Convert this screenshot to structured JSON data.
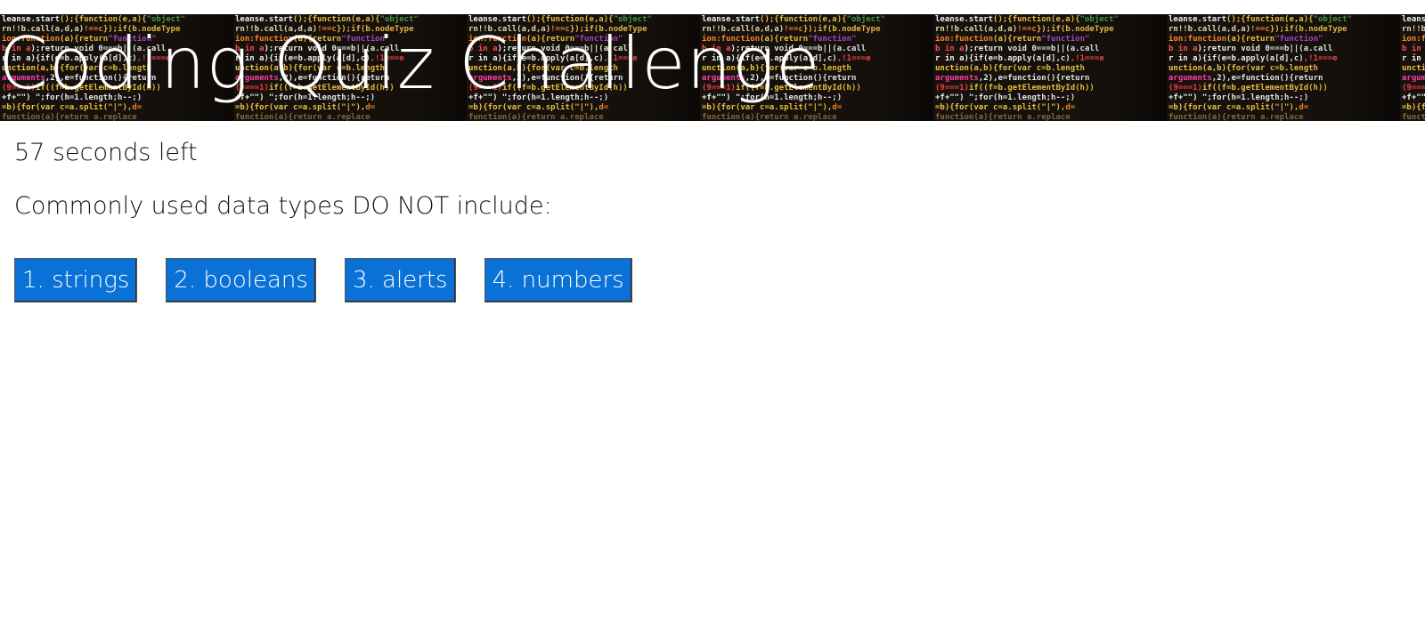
{
  "header": {
    "title": "Coding Quiz Challenge",
    "background_image": "code-screen-image"
  },
  "timer": {
    "text": "57 seconds left"
  },
  "question": {
    "text": "Commonly used data types DO NOT include:"
  },
  "answers": [
    {
      "label": "1. strings"
    },
    {
      "label": "2. booleans"
    },
    {
      "label": "3. alerts"
    },
    {
      "label": "4. numbers"
    }
  ],
  "colors": {
    "answer_button_bg": "#0a72d6",
    "answer_button_text": "#ffffff",
    "title_text": "#ffffff",
    "body_text": "#111111"
  }
}
